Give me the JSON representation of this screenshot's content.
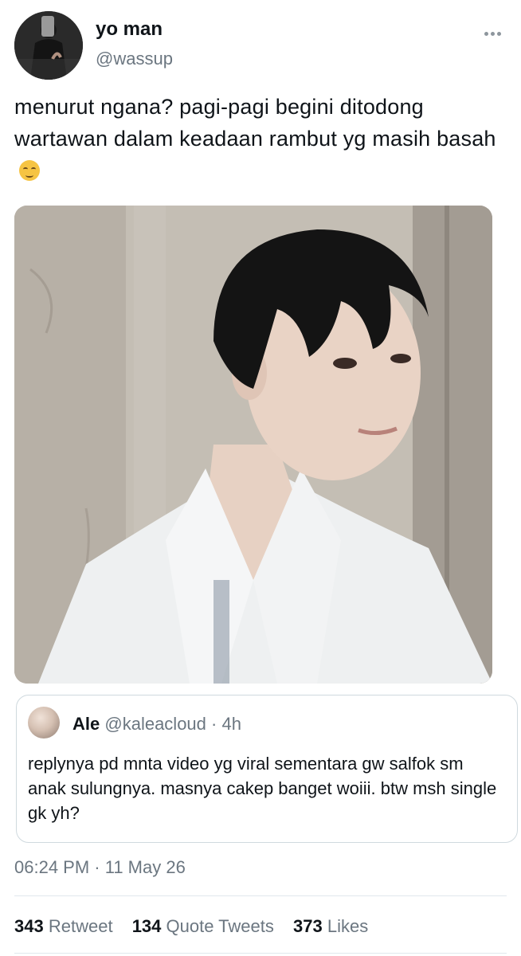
{
  "tweet": {
    "author": {
      "name": "yo man",
      "handle": "@wassup",
      "avatar_icon": "mirror-selfie-avatar"
    },
    "text": "menurut ngana? pagi-pagi begini ditodong wartawan dalam keadaan rambut yg masih basah",
    "emoji": "drooling-face-icon",
    "media": {
      "type": "photo",
      "alt": ""
    },
    "quoted": {
      "name": "Ale",
      "handle": "@kaleacloud",
      "separator": "·",
      "time": "4h",
      "text": "replynya pd mnta video yg viral sementara gw salfok sm anak sulungnya. masnya cakep banget woiii. btw msh single gk yh?"
    },
    "timestamp": "06:24 PM · 11 May 26",
    "stats": {
      "retweets": {
        "count": "343",
        "label": "Retweet"
      },
      "quotes": {
        "count": "134",
        "label": "Quote Tweets"
      },
      "likes": {
        "count": "373",
        "label": "Likes"
      }
    }
  },
  "colors": {
    "text": "#0f1419",
    "secondary": "#6b7680",
    "border": "#cfd9de"
  }
}
